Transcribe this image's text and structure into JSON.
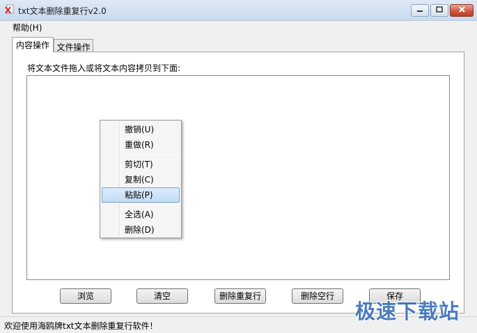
{
  "window": {
    "title": "txt文本删除重复行v2.0",
    "icon": "app-icon",
    "controls": [
      "minimize-icon",
      "maximize-icon",
      "close-icon"
    ]
  },
  "menubar": {
    "help": "帮助(H)"
  },
  "tabs": [
    {
      "label": "内容操作",
      "active": true
    },
    {
      "label": "文件操作",
      "active": false
    }
  ],
  "main": {
    "instruction": "将文本文件拖入或将文本内容拷贝到下面:",
    "textarea_value": ""
  },
  "buttons": {
    "browse": "浏览",
    "clear": "清空",
    "remove_duplicates": "删除重复行",
    "remove_blank": "删除空行",
    "save": "保存"
  },
  "context_menu": {
    "items": [
      {
        "label": "撤销(U)"
      },
      {
        "label": "重做(R)"
      },
      {
        "label": "剪切(T)"
      },
      {
        "label": "复制(C)"
      },
      {
        "label": "粘贴(P)",
        "highlighted": true
      },
      {
        "label": "全选(A)"
      },
      {
        "label": "删除(D)"
      }
    ]
  },
  "status": {
    "text": "欢迎使用海鸥牌txt文本删除重复行软件！"
  },
  "watermark": {
    "text": "极速下载站"
  },
  "colors": {
    "titlebar": "#c9daee",
    "window_bg": "#f0f0f0",
    "menu_highlight": "#c2dcf3",
    "close_button": "#c03b22",
    "watermark": "#3a6fb8"
  }
}
